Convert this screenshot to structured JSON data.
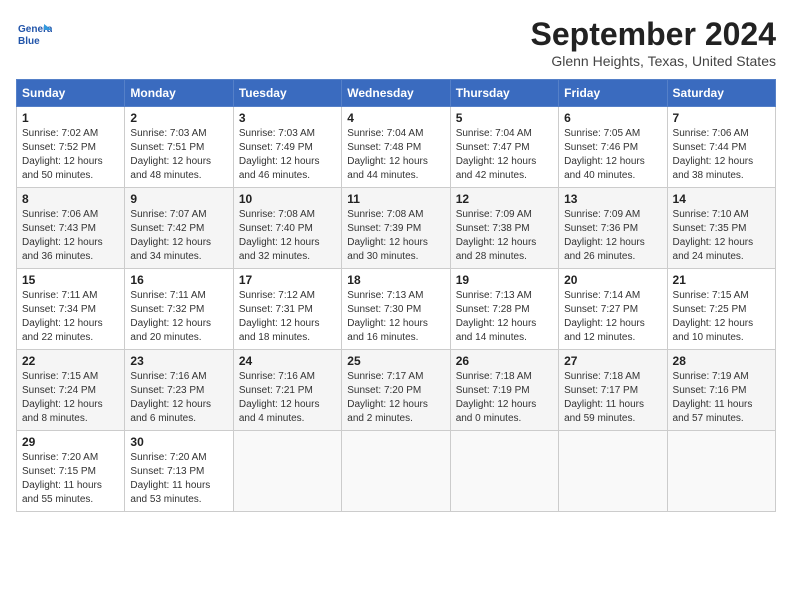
{
  "header": {
    "logo_line1": "General",
    "logo_line2": "Blue",
    "month_title": "September 2024",
    "location": "Glenn Heights, Texas, United States"
  },
  "days_of_week": [
    "Sunday",
    "Monday",
    "Tuesday",
    "Wednesday",
    "Thursday",
    "Friday",
    "Saturday"
  ],
  "weeks": [
    [
      {
        "day": "1",
        "info": "Sunrise: 7:02 AM\nSunset: 7:52 PM\nDaylight: 12 hours\nand 50 minutes."
      },
      {
        "day": "2",
        "info": "Sunrise: 7:03 AM\nSunset: 7:51 PM\nDaylight: 12 hours\nand 48 minutes."
      },
      {
        "day": "3",
        "info": "Sunrise: 7:03 AM\nSunset: 7:49 PM\nDaylight: 12 hours\nand 46 minutes."
      },
      {
        "day": "4",
        "info": "Sunrise: 7:04 AM\nSunset: 7:48 PM\nDaylight: 12 hours\nand 44 minutes."
      },
      {
        "day": "5",
        "info": "Sunrise: 7:04 AM\nSunset: 7:47 PM\nDaylight: 12 hours\nand 42 minutes."
      },
      {
        "day": "6",
        "info": "Sunrise: 7:05 AM\nSunset: 7:46 PM\nDaylight: 12 hours\nand 40 minutes."
      },
      {
        "day": "7",
        "info": "Sunrise: 7:06 AM\nSunset: 7:44 PM\nDaylight: 12 hours\nand 38 minutes."
      }
    ],
    [
      {
        "day": "8",
        "info": "Sunrise: 7:06 AM\nSunset: 7:43 PM\nDaylight: 12 hours\nand 36 minutes."
      },
      {
        "day": "9",
        "info": "Sunrise: 7:07 AM\nSunset: 7:42 PM\nDaylight: 12 hours\nand 34 minutes."
      },
      {
        "day": "10",
        "info": "Sunrise: 7:08 AM\nSunset: 7:40 PM\nDaylight: 12 hours\nand 32 minutes."
      },
      {
        "day": "11",
        "info": "Sunrise: 7:08 AM\nSunset: 7:39 PM\nDaylight: 12 hours\nand 30 minutes."
      },
      {
        "day": "12",
        "info": "Sunrise: 7:09 AM\nSunset: 7:38 PM\nDaylight: 12 hours\nand 28 minutes."
      },
      {
        "day": "13",
        "info": "Sunrise: 7:09 AM\nSunset: 7:36 PM\nDaylight: 12 hours\nand 26 minutes."
      },
      {
        "day": "14",
        "info": "Sunrise: 7:10 AM\nSunset: 7:35 PM\nDaylight: 12 hours\nand 24 minutes."
      }
    ],
    [
      {
        "day": "15",
        "info": "Sunrise: 7:11 AM\nSunset: 7:34 PM\nDaylight: 12 hours\nand 22 minutes."
      },
      {
        "day": "16",
        "info": "Sunrise: 7:11 AM\nSunset: 7:32 PM\nDaylight: 12 hours\nand 20 minutes."
      },
      {
        "day": "17",
        "info": "Sunrise: 7:12 AM\nSunset: 7:31 PM\nDaylight: 12 hours\nand 18 minutes."
      },
      {
        "day": "18",
        "info": "Sunrise: 7:13 AM\nSunset: 7:30 PM\nDaylight: 12 hours\nand 16 minutes."
      },
      {
        "day": "19",
        "info": "Sunrise: 7:13 AM\nSunset: 7:28 PM\nDaylight: 12 hours\nand 14 minutes."
      },
      {
        "day": "20",
        "info": "Sunrise: 7:14 AM\nSunset: 7:27 PM\nDaylight: 12 hours\nand 12 minutes."
      },
      {
        "day": "21",
        "info": "Sunrise: 7:15 AM\nSunset: 7:25 PM\nDaylight: 12 hours\nand 10 minutes."
      }
    ],
    [
      {
        "day": "22",
        "info": "Sunrise: 7:15 AM\nSunset: 7:24 PM\nDaylight: 12 hours\nand 8 minutes."
      },
      {
        "day": "23",
        "info": "Sunrise: 7:16 AM\nSunset: 7:23 PM\nDaylight: 12 hours\nand 6 minutes."
      },
      {
        "day": "24",
        "info": "Sunrise: 7:16 AM\nSunset: 7:21 PM\nDaylight: 12 hours\nand 4 minutes."
      },
      {
        "day": "25",
        "info": "Sunrise: 7:17 AM\nSunset: 7:20 PM\nDaylight: 12 hours\nand 2 minutes."
      },
      {
        "day": "26",
        "info": "Sunrise: 7:18 AM\nSunset: 7:19 PM\nDaylight: 12 hours\nand 0 minutes."
      },
      {
        "day": "27",
        "info": "Sunrise: 7:18 AM\nSunset: 7:17 PM\nDaylight: 11 hours\nand 59 minutes."
      },
      {
        "day": "28",
        "info": "Sunrise: 7:19 AM\nSunset: 7:16 PM\nDaylight: 11 hours\nand 57 minutes."
      }
    ],
    [
      {
        "day": "29",
        "info": "Sunrise: 7:20 AM\nSunset: 7:15 PM\nDaylight: 11 hours\nand 55 minutes."
      },
      {
        "day": "30",
        "info": "Sunrise: 7:20 AM\nSunset: 7:13 PM\nDaylight: 11 hours\nand 53 minutes."
      },
      {
        "day": "",
        "info": ""
      },
      {
        "day": "",
        "info": ""
      },
      {
        "day": "",
        "info": ""
      },
      {
        "day": "",
        "info": ""
      },
      {
        "day": "",
        "info": ""
      }
    ]
  ]
}
